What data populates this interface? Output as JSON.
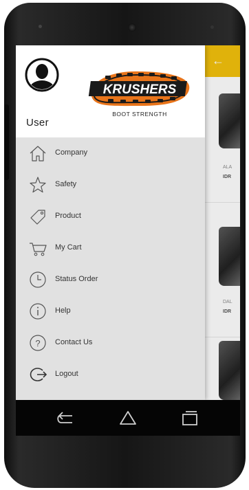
{
  "header": {
    "user_name": "User",
    "logo_text": "KRUSHERS",
    "logo_tagline": "BOOT STRENGTH"
  },
  "menu": [
    {
      "label": "Company",
      "icon": "home-icon"
    },
    {
      "label": "Safety",
      "icon": "star-icon"
    },
    {
      "label": "Product",
      "icon": "tag-icon"
    },
    {
      "label": "My Cart",
      "icon": "cart-icon"
    },
    {
      "label": "Status Order",
      "icon": "clock-icon"
    },
    {
      "label": "Help",
      "icon": "info-icon"
    },
    {
      "label": "Contact Us",
      "icon": "question-icon"
    },
    {
      "label": "Logout",
      "icon": "logout-icon"
    }
  ],
  "products": [
    {
      "name": "ALA",
      "price": "IDR"
    },
    {
      "name": "DAL",
      "price": "IDR"
    }
  ],
  "colors": {
    "accent": "#f4c20d",
    "logo_orange": "#e8741a",
    "drawer_bg": "#e1e1e1"
  }
}
